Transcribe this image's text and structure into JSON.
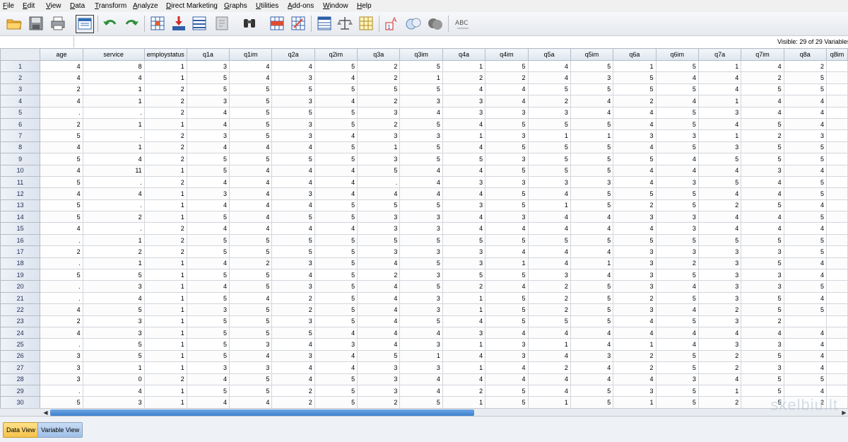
{
  "menu": [
    "File",
    "Edit",
    "View",
    "Data",
    "Transform",
    "Analyze",
    "Direct Marketing",
    "Graphs",
    "Utilities",
    "Add-ons",
    "Window",
    "Help"
  ],
  "toolbar_icons": [
    "open-folder-icon",
    "save-icon",
    "print-icon",
    "recall-dialog-icon",
    "undo-icon",
    "redo-icon",
    "goto-case-icon",
    "goto-variable-icon",
    "variables-icon",
    "run-descriptives-icon",
    "find-icon",
    "insert-cases-icon",
    "insert-variable-icon",
    "split-file-icon",
    "weight-cases-icon",
    "select-cases-icon",
    "value-labels-icon",
    "use-sets-icon",
    "show-all-variables-icon",
    "spell-check-icon"
  ],
  "status": {
    "visible_text": "Visible: 29 of 29 Variables"
  },
  "grid": {
    "columns": [
      "age",
      "service",
      "employstatus",
      "q1a",
      "q1im",
      "q2a",
      "q2im",
      "q3a",
      "q3im",
      "q4a",
      "q4im",
      "q5a",
      "q5im",
      "q6a",
      "q6im",
      "q7a",
      "q7im",
      "q8a",
      "q8im"
    ],
    "rows": [
      [
        "4",
        "8",
        "1",
        "3",
        "4",
        "4",
        "5",
        "2",
        "5",
        "1",
        "5",
        "4",
        "5",
        "1",
        "5",
        "1",
        "4",
        "2",
        ""
      ],
      [
        "4",
        "4",
        "1",
        "5",
        "4",
        "3",
        "4",
        "2",
        "1",
        "2",
        "2",
        "4",
        "3",
        "5",
        "4",
        "4",
        "2",
        "5",
        ""
      ],
      [
        "2",
        "1",
        "2",
        "5",
        "5",
        "5",
        "5",
        "5",
        "5",
        "4",
        "4",
        "5",
        "5",
        "5",
        "5",
        "4",
        "5",
        "5",
        ""
      ],
      [
        "4",
        "1",
        "2",
        "3",
        "5",
        "3",
        "4",
        "2",
        "3",
        "3",
        "4",
        "2",
        "4",
        "2",
        "4",
        "1",
        "4",
        "4",
        ""
      ],
      [
        ".",
        ".",
        "2",
        "4",
        "5",
        "5",
        "5",
        "3",
        "4",
        "3",
        "3",
        "3",
        "4",
        "4",
        "5",
        "3",
        "4",
        "4",
        ""
      ],
      [
        "2",
        "1",
        "1",
        "4",
        "5",
        "3",
        "5",
        "2",
        "5",
        "4",
        "5",
        "5",
        "5",
        "4",
        "5",
        "4",
        "5",
        "4",
        ""
      ],
      [
        "5",
        ".",
        "2",
        "3",
        "5",
        "3",
        "4",
        "3",
        "3",
        "1",
        "3",
        "1",
        "1",
        "3",
        "3",
        "1",
        "2",
        "3",
        ""
      ],
      [
        "4",
        "1",
        "2",
        "4",
        "4",
        "4",
        "5",
        "1",
        "5",
        "4",
        "5",
        "5",
        "5",
        "4",
        "5",
        "3",
        "5",
        "5",
        ""
      ],
      [
        "5",
        "4",
        "2",
        "5",
        "5",
        "5",
        "5",
        "3",
        "5",
        "5",
        "3",
        "5",
        "5",
        "5",
        "4",
        "5",
        "5",
        "5",
        ""
      ],
      [
        "4",
        "11",
        "1",
        "5",
        "4",
        "4",
        "4",
        "5",
        "4",
        "4",
        "5",
        "5",
        "5",
        "4",
        "4",
        "4",
        "3",
        "4",
        ""
      ],
      [
        "5",
        ".",
        "2",
        "4",
        "4",
        "4",
        "4",
        ".",
        "4",
        "3",
        "3",
        "3",
        "3",
        "4",
        "3",
        "5",
        "4",
        "5",
        ""
      ],
      [
        "4",
        "4",
        "1",
        "3",
        "4",
        "3",
        "4",
        "4",
        "4",
        "4",
        "5",
        "4",
        "5",
        "5",
        "5",
        "4",
        "4",
        "5",
        ""
      ],
      [
        "5",
        ".",
        "1",
        "4",
        "4",
        "4",
        "5",
        "5",
        "5",
        "3",
        "5",
        "1",
        "5",
        "2",
        "5",
        "2",
        "5",
        "4",
        ""
      ],
      [
        "5",
        "2",
        "1",
        "5",
        "4",
        "5",
        "5",
        "3",
        "3",
        "4",
        "3",
        "4",
        "4",
        "3",
        "3",
        "4",
        "4",
        "5",
        ""
      ],
      [
        "4",
        ".",
        "2",
        "4",
        "4",
        "4",
        "4",
        "3",
        "3",
        "4",
        "4",
        "4",
        "4",
        "4",
        "3",
        "4",
        "4",
        "4",
        ""
      ],
      [
        ".",
        "1",
        "2",
        "5",
        "5",
        "5",
        "5",
        "5",
        "5",
        "5",
        "5",
        "5",
        "5",
        "5",
        "5",
        "5",
        "5",
        "5",
        ""
      ],
      [
        "2",
        "2",
        "2",
        "5",
        "5",
        "5",
        "5",
        "3",
        "3",
        "3",
        "4",
        "4",
        "4",
        "3",
        "3",
        "3",
        "3",
        "5",
        ""
      ],
      [
        ".",
        "1",
        "1",
        "4",
        "2",
        "3",
        "5",
        "4",
        "5",
        "3",
        "1",
        "4",
        "1",
        "3",
        "2",
        "3",
        "5",
        "4",
        ""
      ],
      [
        "5",
        "5",
        "1",
        "5",
        "5",
        "4",
        "5",
        "2",
        "3",
        "5",
        "5",
        "3",
        "4",
        "3",
        "5",
        "3",
        "3",
        "4",
        ""
      ],
      [
        ".",
        "3",
        "1",
        "4",
        "5",
        "3",
        "5",
        "4",
        "5",
        "2",
        "4",
        "2",
        "5",
        "3",
        "4",
        "3",
        "3",
        "5",
        ""
      ],
      [
        ".",
        "4",
        "1",
        "5",
        "4",
        "2",
        "5",
        "4",
        "3",
        "1",
        "5",
        "2",
        "5",
        "2",
        "5",
        "3",
        "5",
        "4",
        ""
      ],
      [
        "4",
        "5",
        "1",
        "3",
        "5",
        "2",
        "5",
        "4",
        "3",
        "1",
        "5",
        "2",
        "5",
        "3",
        "4",
        "2",
        "5",
        "5",
        ""
      ],
      [
        "2",
        "3",
        "1",
        "5",
        "5",
        "3",
        "5",
        "4",
        "5",
        "4",
        "5",
        "5",
        "5",
        "4",
        "5",
        "3",
        "2",
        "",
        ""
      ],
      [
        "4",
        "3",
        "1",
        "5",
        "5",
        "5",
        "4",
        "4",
        "4",
        "3",
        "4",
        "4",
        "4",
        "4",
        "4",
        "4",
        "4",
        "4",
        ""
      ],
      [
        ".",
        "5",
        "1",
        "5",
        "3",
        "4",
        "3",
        "4",
        "3",
        "1",
        "3",
        "1",
        "4",
        "1",
        "4",
        "3",
        "3",
        "4",
        ""
      ],
      [
        "3",
        "5",
        "1",
        "5",
        "4",
        "3",
        "4",
        "5",
        "1",
        "4",
        "3",
        "4",
        "3",
        "2",
        "5",
        "2",
        "5",
        "4",
        ""
      ],
      [
        "3",
        "1",
        "1",
        "3",
        "3",
        "4",
        "4",
        "3",
        "3",
        "1",
        "4",
        "2",
        "4",
        "2",
        "5",
        "2",
        "3",
        "4",
        ""
      ],
      [
        "3",
        "0",
        "2",
        "4",
        "5",
        "4",
        "5",
        "3",
        "4",
        "4",
        "4",
        "4",
        "4",
        "4",
        "3",
        "4",
        "5",
        "5",
        ""
      ],
      [
        ".",
        "4",
        "1",
        "5",
        "5",
        "2",
        "5",
        "3",
        "4",
        "2",
        "5",
        "4",
        "5",
        "3",
        "5",
        "1",
        "5",
        "4",
        ""
      ],
      [
        "5",
        "3",
        "1",
        "4",
        "4",
        "2",
        "5",
        "2",
        "5",
        "1",
        "5",
        "1",
        "5",
        "1",
        "5",
        "2",
        "5",
        "2",
        ""
      ]
    ]
  },
  "tabs": {
    "data_view": "Data View",
    "variable_view": "Variable View"
  },
  "watermark_text": "skelbiu.lt"
}
